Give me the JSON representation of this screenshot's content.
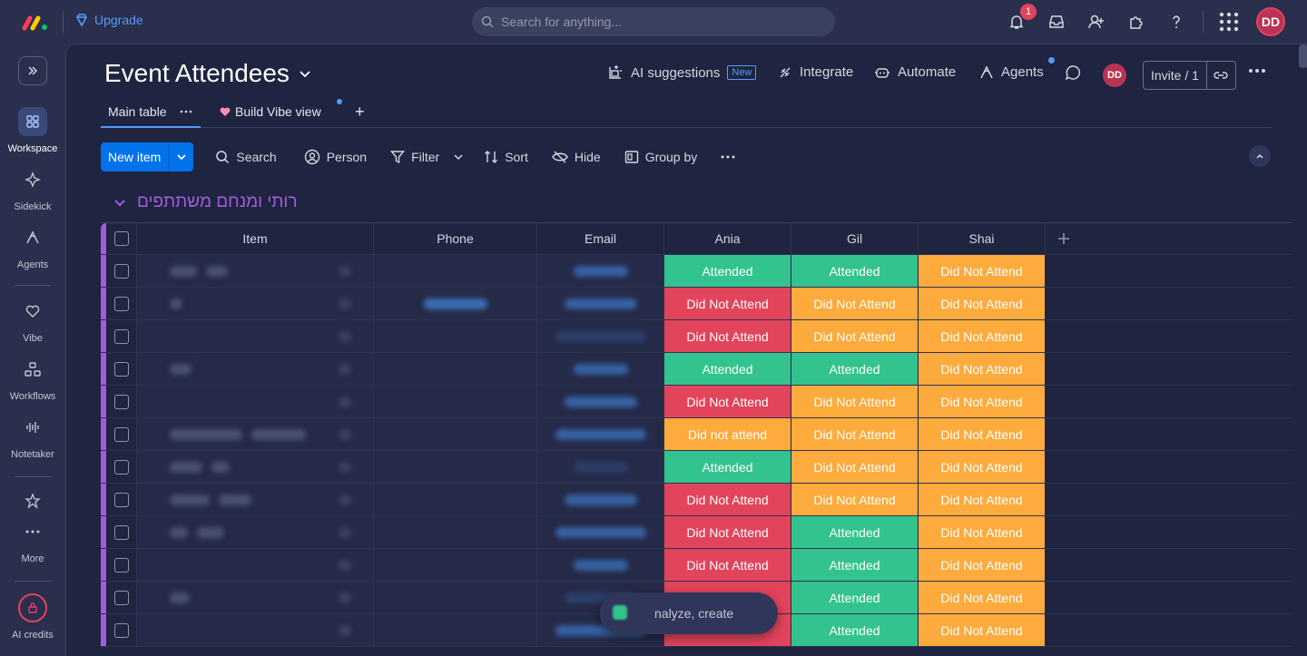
{
  "topbar": {
    "upgrade_label": "Upgrade",
    "search_placeholder": "Search for anything...",
    "notification_count": "1",
    "avatar_initials": "DD"
  },
  "sidebar": {
    "items": [
      {
        "label": "Workspace",
        "icon": "grid-icon"
      },
      {
        "label": "Sidekick",
        "icon": "sparkle-icon"
      },
      {
        "label": "Agents",
        "icon": "agents-icon"
      },
      {
        "label": "Vibe",
        "icon": "heart-icon"
      },
      {
        "label": "Workflows",
        "icon": "workflows-icon"
      },
      {
        "label": "Notetaker",
        "icon": "waveform-icon"
      },
      {
        "label": "More",
        "icon": "more-icon"
      },
      {
        "label": "AI credits",
        "icon": "lock-icon"
      }
    ]
  },
  "board": {
    "title": "Event Attendees",
    "actions": {
      "ai_suggestions": "AI suggestions",
      "new_tag": "New",
      "integrate": "Integrate",
      "automate": "Automate",
      "agents": "Agents",
      "avatar": "DD",
      "invite": "Invite / 1"
    },
    "tabs": [
      {
        "label": "Main table"
      },
      {
        "label": "Build Vibe view"
      }
    ]
  },
  "toolbar": {
    "new_item": "New item",
    "search": "Search",
    "person": "Person",
    "filter": "Filter",
    "sort": "Sort",
    "hide": "Hide",
    "group_by": "Group by"
  },
  "group": {
    "title": "רותי ומנחם משתתפים",
    "color": "#a25ddc"
  },
  "table": {
    "columns": [
      "Item",
      "Phone",
      "Email",
      "Ania",
      "Gil",
      "Shai"
    ],
    "rows": [
      [
        "Attended",
        "Attended",
        "Did Not Attend"
      ],
      [
        "Did Not Attend",
        "Did Not Attend",
        "Did Not Attend"
      ],
      [
        "Did Not Attend",
        "Did Not Attend",
        "Did Not Attend"
      ],
      [
        "Attended",
        "Attended",
        "Did Not Attend"
      ],
      [
        "Did Not Attend",
        "Did Not Attend",
        "Did Not Attend"
      ],
      [
        "Did not attend",
        "Did Not Attend",
        "Did Not Attend"
      ],
      [
        "Attended",
        "Did Not Attend",
        "Did Not Attend"
      ],
      [
        "Did Not Attend",
        "Did Not Attend",
        "Did Not Attend"
      ],
      [
        "Did Not Attend",
        "Attended",
        "Did Not Attend"
      ],
      [
        "Did Not Attend",
        "Attended",
        "Did Not Attend"
      ],
      [
        "",
        "Attended",
        "Did Not Attend"
      ],
      [
        "",
        "Attended",
        "Did Not Attend"
      ]
    ],
    "colors": {
      "attended": "#33c38e",
      "did_not_attend_orange": "#fdab3d",
      "did_not_attend_red": "#e2445c"
    }
  },
  "ai_pill": {
    "text": "nalyze, create"
  }
}
